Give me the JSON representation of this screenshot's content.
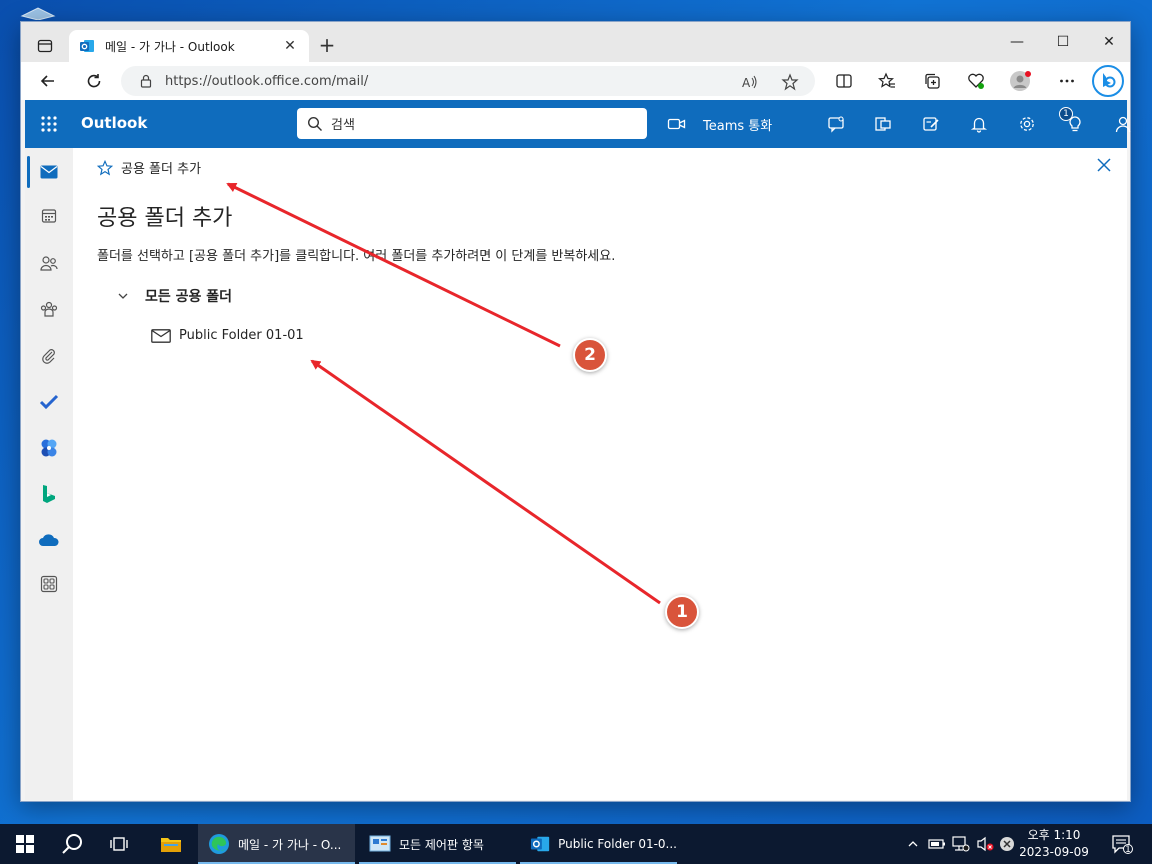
{
  "browser": {
    "tab_title": "메일 - 가 가나 - Outlook",
    "url": "https://outlook.office.com/mail/",
    "accent": "#0f6cbd"
  },
  "outlook": {
    "brand": "Outlook",
    "search_placeholder": "검색",
    "teams_call": "Teams 통화",
    "notification_count": "1"
  },
  "panel": {
    "breadcrumb": "공용 폴더 추가",
    "title": "공용 폴더 추가",
    "instruction": "폴더를 선택하고 [공용 폴더 추가]를 클릭합니다. 여러 폴더를 추가하려면 이 단계를 반복하세요.",
    "tree_root": "모든 공용 폴더",
    "tree_child": "Public Folder 01-01"
  },
  "annotations": {
    "marker1": "1",
    "marker2": "2",
    "color": "#e8262b"
  },
  "taskbar": {
    "apps": [
      {
        "label": "메일 - 가 가나 - O..."
      },
      {
        "label": "모든 제어판 항목"
      },
      {
        "label": "Public Folder 01-0..."
      }
    ],
    "time": "오후 1:10",
    "date": "2023-09-09",
    "notification_count": "1"
  }
}
